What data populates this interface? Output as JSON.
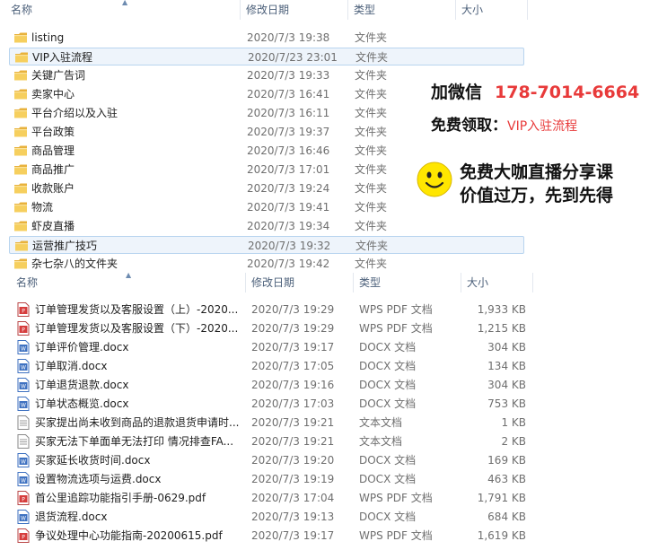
{
  "folder_header": {
    "name": "名称",
    "date": "修改日期",
    "type": "类型",
    "size": "大小"
  },
  "folders": [
    {
      "name": "listing",
      "date": "2020/7/3 19:38",
      "type": "文件夹"
    },
    {
      "name": "VIP入驻流程",
      "date": "2020/7/23 23:01",
      "type": "文件夹",
      "selected": true
    },
    {
      "name": "关键广告词",
      "date": "2020/7/3 19:33",
      "type": "文件夹"
    },
    {
      "name": "卖家中心",
      "date": "2020/7/3 16:41",
      "type": "文件夹"
    },
    {
      "name": "平台介绍以及入驻",
      "date": "2020/7/3 16:11",
      "type": "文件夹"
    },
    {
      "name": "平台政策",
      "date": "2020/7/3 19:37",
      "type": "文件夹"
    },
    {
      "name": "商品管理",
      "date": "2020/7/3 16:46",
      "type": "文件夹"
    },
    {
      "name": "商品推广",
      "date": "2020/7/3 17:01",
      "type": "文件夹"
    },
    {
      "name": "收款账户",
      "date": "2020/7/3 19:24",
      "type": "文件夹"
    },
    {
      "name": "物流",
      "date": "2020/7/3 19:41",
      "type": "文件夹"
    },
    {
      "name": "虾皮直播",
      "date": "2020/7/3 19:34",
      "type": "文件夹"
    },
    {
      "name": "运营推广技巧",
      "date": "2020/7/3 19:32",
      "type": "文件夹",
      "selected": true
    },
    {
      "name": "杂七杂八的文件夹",
      "date": "2020/7/3 19:42",
      "type": "文件夹"
    }
  ],
  "file_header": {
    "name": "名称",
    "date": "修改日期",
    "type": "类型",
    "size": "大小"
  },
  "files": [
    {
      "name": "订单管理发货以及客服设置（上）-2020...",
      "date": "2020/7/3 19:29",
      "type": "WPS PDF 文档",
      "size": "1,933 KB",
      "icon": "pdf-icon"
    },
    {
      "name": "订单管理发货以及客服设置（下）-2020...",
      "date": "2020/7/3 19:29",
      "type": "WPS PDF 文档",
      "size": "1,215 KB",
      "icon": "pdf-icon"
    },
    {
      "name": "订单评价管理.docx",
      "date": "2020/7/3 19:17",
      "type": "DOCX 文档",
      "size": "304 KB",
      "icon": "docx-icon"
    },
    {
      "name": "订单取消.docx",
      "date": "2020/7/3 17:05",
      "type": "DOCX 文档",
      "size": "134 KB",
      "icon": "docx-icon"
    },
    {
      "name": "订单退货退款.docx",
      "date": "2020/7/3 19:16",
      "type": "DOCX 文档",
      "size": "304 KB",
      "icon": "docx-icon"
    },
    {
      "name": "订单状态概览.docx",
      "date": "2020/7/3 17:03",
      "type": "DOCX 文档",
      "size": "753 KB",
      "icon": "docx-icon"
    },
    {
      "name": "买家提出尚未收到商品的退款退货申请时...",
      "date": "2020/7/3 19:21",
      "type": "文本文档",
      "size": "1 KB",
      "icon": "txt-icon"
    },
    {
      "name": "买家无法下单面单无法打印 情况排查FA...",
      "date": "2020/7/3 19:21",
      "type": "文本文档",
      "size": "2 KB",
      "icon": "txt-icon"
    },
    {
      "name": "买家延长收货时间.docx",
      "date": "2020/7/3 19:20",
      "type": "DOCX 文档",
      "size": "169 KB",
      "icon": "docx-icon"
    },
    {
      "name": "设置物流选项与运费.docx",
      "date": "2020/7/3 19:19",
      "type": "DOCX 文档",
      "size": "463 KB",
      "icon": "docx-icon"
    },
    {
      "name": "首公里追踪功能指引手册-0629.pdf",
      "date": "2020/7/3 17:04",
      "type": "WPS PDF 文档",
      "size": "1,791 KB",
      "icon": "pdf-icon"
    },
    {
      "name": "退货流程.docx",
      "date": "2020/7/3 19:13",
      "type": "DOCX 文档",
      "size": "684 KB",
      "icon": "docx-icon"
    },
    {
      "name": "争议处理中心功能指南-20200615.pdf",
      "date": "2020/7/3 19:17",
      "type": "WPS PDF 文档",
      "size": "1,619 KB",
      "icon": "pdf-icon"
    }
  ],
  "overlay": {
    "wechat_label": "加微信",
    "wechat_number": "178-7014-6664",
    "free_label": "免费领取：",
    "free_item": "VIP入驻流程",
    "line3": "免费大咖直播分享课",
    "line4": "价值过万，先到先得"
  },
  "colors": {
    "accent_red": "#e83a3a",
    "selection_border": "#b8d4ef",
    "folder_yellow": "#f2c14e"
  }
}
